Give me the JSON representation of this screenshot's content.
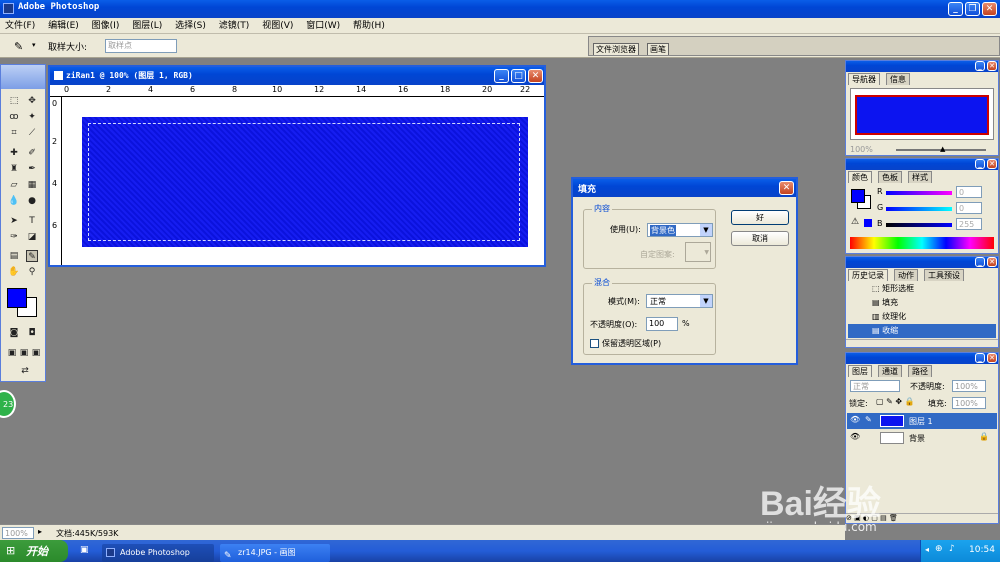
{
  "app": {
    "title": "Adobe Photoshop"
  },
  "menu": [
    "文件(F)",
    "编辑(E)",
    "图像(I)",
    "图层(L)",
    "选择(S)",
    "滤镜(T)",
    "视图(V)",
    "窗口(W)",
    "帮助(H)"
  ],
  "options_bar": {
    "sample_size_label": "取样大小:",
    "sample_size_value": "取样点",
    "tabs": [
      "文件浏览器",
      "画笔"
    ]
  },
  "document": {
    "title": "ziRan1 @ 100% (图层 1, RGB)",
    "ruler_numbers": [
      "0",
      "2",
      "4",
      "6",
      "8",
      "10",
      "12",
      "14",
      "16",
      "18",
      "20",
      "22"
    ],
    "vruler_numbers": [
      "0",
      "2",
      "4",
      "6"
    ],
    "fill_color": "#0c14f0"
  },
  "fill_dialog": {
    "title": "填充",
    "content_group": "内容",
    "use_label": "使用(U):",
    "use_value": "背景色",
    "custom_pattern_label": "自定图案:",
    "blend_group": "混合",
    "mode_label": "模式(M):",
    "mode_value": "正常",
    "opacity_label": "不透明度(O):",
    "opacity_value": "100",
    "opacity_unit": "%",
    "preserve_label": "保留透明区域(P)",
    "ok_label": "好",
    "cancel_label": "取消"
  },
  "navigator": {
    "tabs": [
      "导航器",
      "信息"
    ],
    "zoom": "100%"
  },
  "color_panel": {
    "tabs": [
      "颜色",
      "色板",
      "样式"
    ],
    "r_label": "R",
    "g_label": "G",
    "b_label": "B",
    "r_value": "0",
    "g_value": "0",
    "b_value": "255"
  },
  "history_panel": {
    "tabs": [
      "历史记录",
      "动作",
      "工具预设"
    ],
    "items": [
      "矩形选框",
      "填充",
      "纹理化",
      "收缩"
    ],
    "active_index": 3
  },
  "layers_panel": {
    "tabs": [
      "图层",
      "通道",
      "路径"
    ],
    "blend_mode": "正常",
    "opacity_label": "不透明度:",
    "opacity_value": "100%",
    "lock_label": "锁定:",
    "fill_label": "填充:",
    "fill_value": "100%",
    "layers": [
      {
        "name": "图层 1",
        "selected": true
      },
      {
        "name": "背景",
        "selected": false
      }
    ]
  },
  "status_bar": {
    "zoom": "100%",
    "doc_info": "文档:445K/593K"
  },
  "badge_number": "23",
  "taskbar": {
    "start_label": "开始",
    "items": [
      "Adobe Photoshop",
      "zr14.JPG - 画图"
    ],
    "clock": "10:54"
  },
  "watermark": {
    "brand": "Bai经验",
    "url": "jingyan.baidu.com"
  },
  "colors": {
    "foreground": "#0000ff",
    "background": "#ffffff",
    "accent": "#0046d5"
  }
}
